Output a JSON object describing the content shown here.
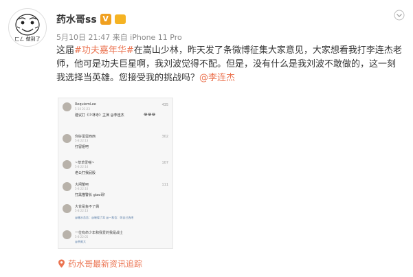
{
  "post": {
    "author": "药水哥ss",
    "verified_badge": "V",
    "avatar_caption": "ㄈㄥ 做到了",
    "meta": "5月10日 21:47 来自 iPhone 11 Pro",
    "text_prefix": "这届",
    "hashtag": "#功夫嘉年华#",
    "text_main": "在嵩山少林，昨天发了条微博征集大家意见，大家想看我打李连杰老师，他可是功夫巨星啊，我刘波觉得不配。但是，没有什么是我刘波不敢做的，这一刻我选择当英雄。您接受我的挑战吗？",
    "mention": "@李连杰",
    "footer": "药水哥最新资讯追踪"
  },
  "screenshot": {
    "comments": [
      {
        "name": "RequiemLee",
        "time": "5-10 21:23",
        "likes": "435",
        "body": "建议打《少林寺》主演 @李连杰"
      },
      {
        "name": "你好蛋蛋西西",
        "time": "5-8 22:13",
        "likes": "302",
        "body": "打留姐吧"
      },
      {
        "name": "~草草爱喵~",
        "time": "5-8 22:14",
        "likes": "107",
        "body": "老公打我屁股"
      },
      {
        "name": "大闸蟹吧",
        "time": "5-8 22:10",
        "likes": "111",
        "body": "打黑猫警长 giao哥！"
      },
      {
        "name": "大雀是鱼不了偶",
        "time": "5-8 22:13",
        "likes": "",
        "body": "",
        "sub": "@糖水吾吾：@璀璨了耳 @一和吾：你自己选吧"
      },
      {
        "name": "一位有命少年和我爱的我是战士",
        "time": "5-8 22:05",
        "likes": "",
        "body": "",
        "sub": "@茶勋大"
      }
    ]
  },
  "colors": {
    "accent": "#eb7350",
    "badge": "#f0a020",
    "link": "#5a7ea8"
  }
}
